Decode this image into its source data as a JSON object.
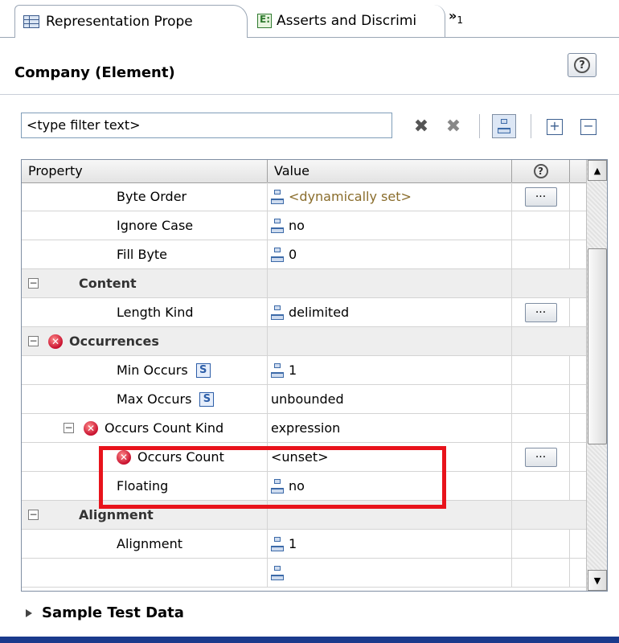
{
  "tabs": [
    {
      "label": "Representation Prope",
      "active": true,
      "icon": "table-icon"
    },
    {
      "label": "Asserts and Discrimi",
      "active": false,
      "icon": "asserts-icon"
    }
  ],
  "tab_overflow": {
    "chevron": "»",
    "count": "1"
  },
  "header": {
    "title": "Company (Element)",
    "help_icon": "?"
  },
  "filter": {
    "value": "<type filter text>"
  },
  "toolbar": {
    "clear_label": "✖",
    "clear_all_label": "✖",
    "show_tree_label": "tree",
    "expand_all": "+",
    "collapse_all": "−"
  },
  "grid": {
    "columns": {
      "property": "Property",
      "value": "Value",
      "help": "?"
    },
    "rows": [
      {
        "type": "prop",
        "name": "Byte Order",
        "value": "<dynamically set>",
        "value_icon": "tree-icon",
        "dynamic": true,
        "button": "..."
      },
      {
        "type": "prop",
        "name": "Ignore Case",
        "value": "no",
        "value_icon": "tree-icon"
      },
      {
        "type": "prop",
        "name": "Fill Byte",
        "value": "0",
        "value_icon": "tree-icon"
      },
      {
        "type": "category",
        "name": "Content",
        "expander": "−"
      },
      {
        "type": "prop",
        "name": "Length Kind",
        "value": "delimited",
        "value_icon": "tree-icon",
        "button": "..."
      },
      {
        "type": "category",
        "name": "Occurrences",
        "expander": "−",
        "error": true
      },
      {
        "type": "prop",
        "name": "Min Occurs",
        "badge": "S",
        "value": "1",
        "value_icon": "tree-icon"
      },
      {
        "type": "prop",
        "name": "Max Occurs",
        "badge": "S",
        "value": "unbounded"
      },
      {
        "type": "prop",
        "name": "Occurs Count Kind",
        "value": "expression",
        "error": true,
        "expander": "−"
      },
      {
        "type": "prop",
        "name": "Occurs Count",
        "value": "<unset>",
        "error": true,
        "button": "..."
      },
      {
        "type": "prop",
        "name": "Floating",
        "value": "no",
        "value_icon": "tree-icon"
      },
      {
        "type": "category",
        "name": "Alignment",
        "expander": "−"
      },
      {
        "type": "prop",
        "name": "Alignment",
        "value": "1",
        "value_icon": "tree-icon"
      }
    ]
  },
  "footer": {
    "section_title": "Sample Test Data"
  },
  "colors": {
    "highlight": "#e8131b",
    "dynamic_value": "#8a6d2c",
    "error": "#c8102e"
  }
}
